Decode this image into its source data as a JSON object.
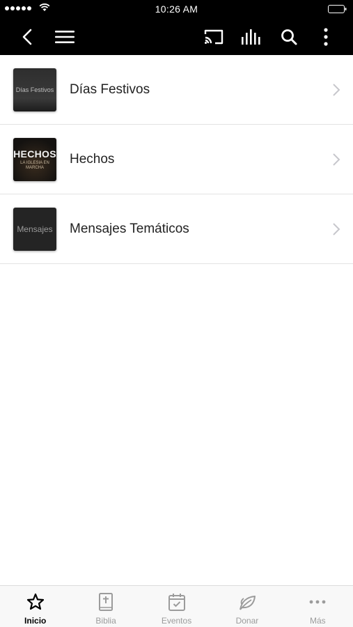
{
  "status_bar": {
    "time": "10:26 AM"
  },
  "list": {
    "items": [
      {
        "label": "Días Festivos",
        "thumb_text": "Días Festivos"
      },
      {
        "label": "Hechos",
        "thumb_title": "HECHOS",
        "thumb_subtitle": "LA IGLESIA EN MARCHA"
      },
      {
        "label": "Mensajes Temáticos",
        "thumb_text": "Mensajes"
      }
    ]
  },
  "tab_bar": {
    "tabs": [
      {
        "label": "Inicio",
        "icon": "star-icon",
        "active": true
      },
      {
        "label": "Biblia",
        "icon": "bible-icon",
        "active": false
      },
      {
        "label": "Eventos",
        "icon": "calendar-icon",
        "active": false
      },
      {
        "label": "Donar",
        "icon": "leaf-icon",
        "active": false
      },
      {
        "label": "Más",
        "icon": "more-horizontal-icon",
        "active": false
      }
    ]
  },
  "colors": {
    "header_bg": "#000000",
    "inactive_tab": "#9b9b9b",
    "active_tab": "#000000"
  }
}
